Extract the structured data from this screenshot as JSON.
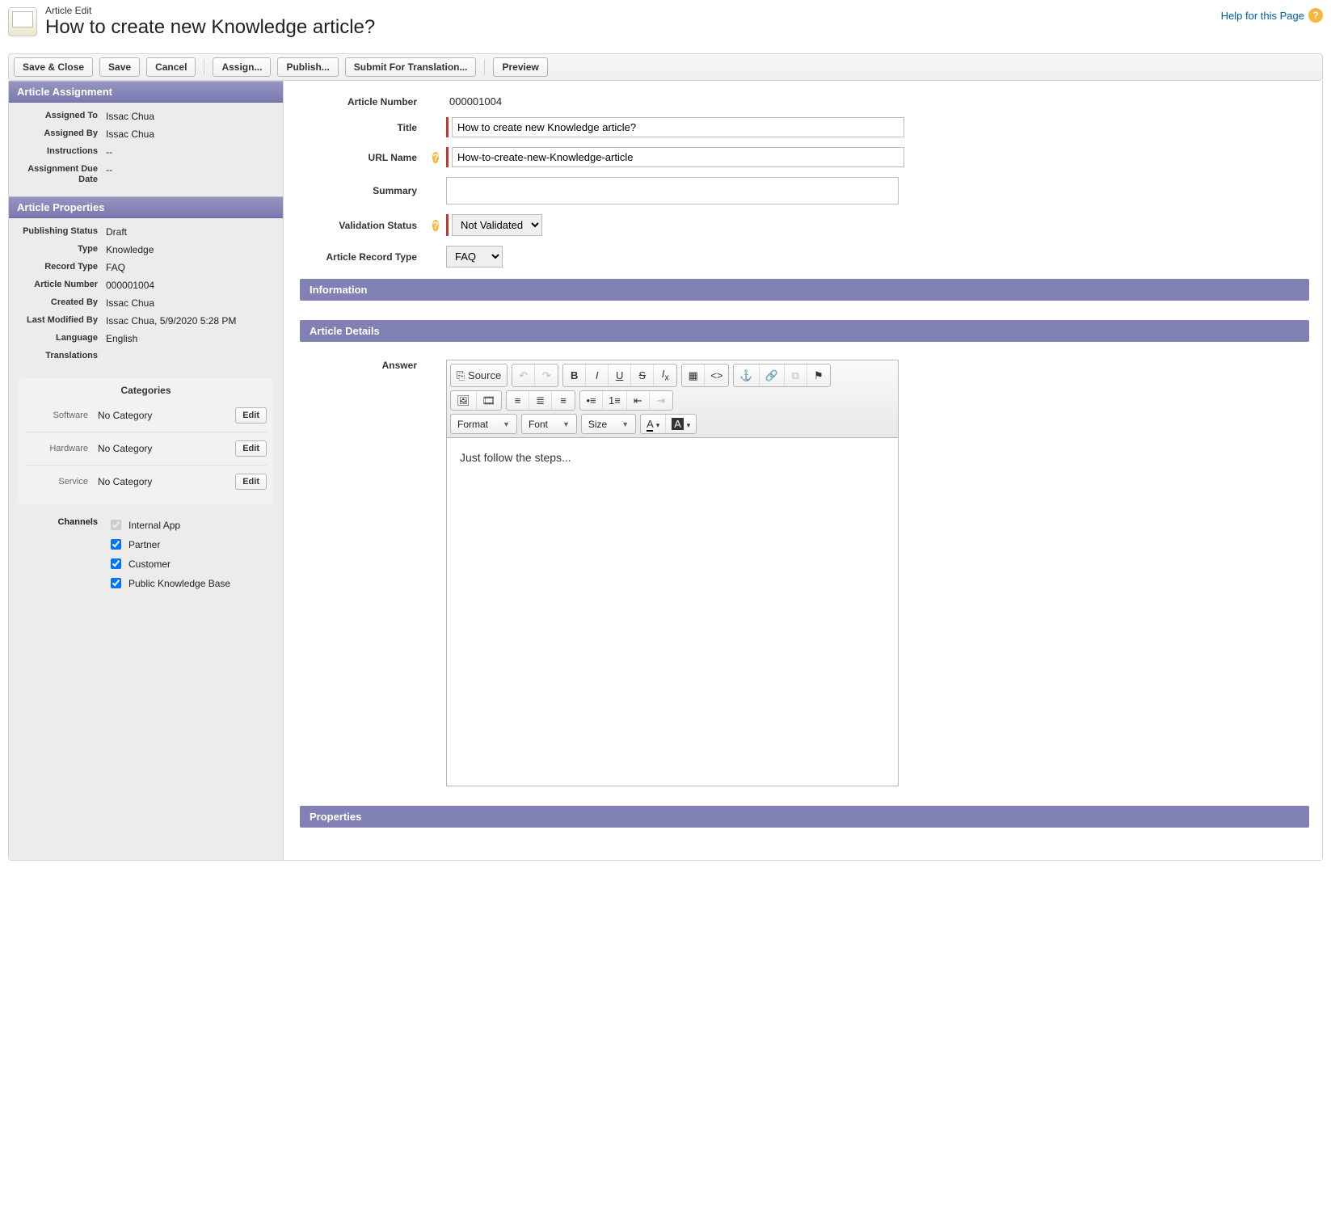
{
  "header": {
    "page_type": "Article Edit",
    "page_title": "How to create new Knowledge article?",
    "help_label": "Help for this Page"
  },
  "toolbar": {
    "save_close": "Save & Close",
    "save": "Save",
    "cancel": "Cancel",
    "assign": "Assign...",
    "publish": "Publish...",
    "submit_translation": "Submit For Translation...",
    "preview": "Preview"
  },
  "sidebar": {
    "assignment": {
      "title": "Article Assignment",
      "assigned_to_label": "Assigned To",
      "assigned_to": "Issac Chua",
      "assigned_by_label": "Assigned By",
      "assigned_by": "Issac Chua",
      "instructions_label": "Instructions",
      "instructions": "--",
      "due_date_label": "Assignment Due Date",
      "due_date": "--"
    },
    "properties": {
      "title": "Article Properties",
      "publishing_status_label": "Publishing Status",
      "publishing_status": "Draft",
      "type_label": "Type",
      "type": "Knowledge",
      "record_type_label": "Record Type",
      "record_type": "FAQ",
      "article_number_label": "Article Number",
      "article_number": "000001004",
      "created_by_label": "Created By",
      "created_by": "Issac Chua",
      "last_modified_by_label": "Last Modified By",
      "last_modified_by": "Issac Chua, 5/9/2020 5:28 PM",
      "language_label": "Language",
      "language": "English",
      "translations_label": "Translations"
    },
    "categories": {
      "title": "Categories",
      "edit_label": "Edit",
      "rows": [
        {
          "label": "Software",
          "value": "No Category"
        },
        {
          "label": "Hardware",
          "value": "No Category"
        },
        {
          "label": "Service",
          "value": "No Category"
        }
      ]
    },
    "channels": {
      "label": "Channels",
      "items": [
        {
          "label": "Internal App",
          "checked": true,
          "disabled": true
        },
        {
          "label": "Partner",
          "checked": true,
          "disabled": false
        },
        {
          "label": "Customer",
          "checked": true,
          "disabled": false
        },
        {
          "label": "Public Knowledge Base",
          "checked": true,
          "disabled": false
        }
      ]
    }
  },
  "form": {
    "article_number_label": "Article Number",
    "article_number": "000001004",
    "title_label": "Title",
    "title_value": "How to create new Knowledge article?",
    "url_name_label": "URL Name",
    "url_name_value": "How-to-create-new-Knowledge-article",
    "summary_label": "Summary",
    "summary_value": "",
    "validation_status_label": "Validation Status",
    "validation_status_value": "Not Validated",
    "article_record_type_label": "Article Record Type",
    "article_record_type_value": "FAQ"
  },
  "sections": {
    "information": "Information",
    "article_details": "Article Details",
    "properties": "Properties"
  },
  "editor": {
    "answer_label": "Answer",
    "source_label": "Source",
    "format_label": "Format",
    "font_label": "Font",
    "size_label": "Size",
    "body": "Just follow the steps..."
  }
}
